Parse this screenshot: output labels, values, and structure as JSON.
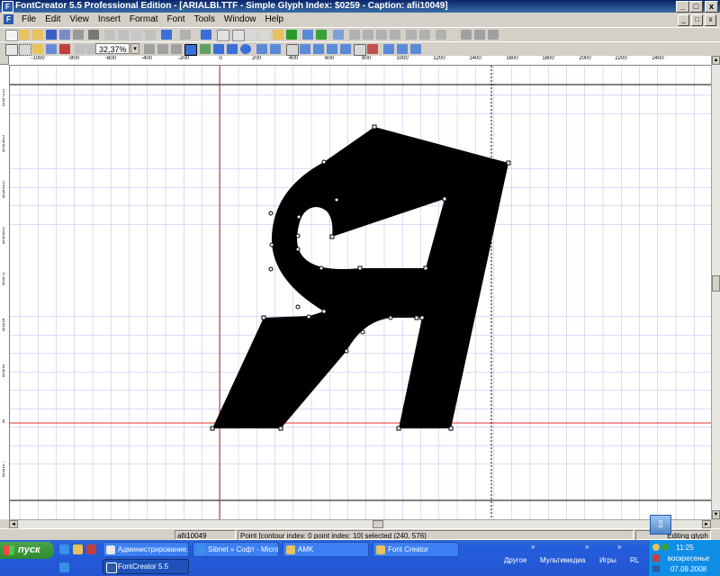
{
  "window": {
    "title": "FontCreator 5.5 Professional Edition - [ARIALBI.TTF - Simple Glyph Index: $0259 - Caption: afii10049]",
    "app_icon": "F",
    "minimize": "_",
    "maximize": "□",
    "close": "x"
  },
  "menu": {
    "doc_icon": "F",
    "items": [
      "File",
      "Edit",
      "View",
      "Insert",
      "Format",
      "Font",
      "Tools",
      "Window",
      "Help"
    ],
    "doc_buttons": [
      "_",
      "□",
      "x"
    ]
  },
  "toolbar2": {
    "zoom_value": "32,37%",
    "zoom_arrow": "▾"
  },
  "rulers": {
    "h_labels": [
      "-1000",
      "-800",
      "-600",
      "-400",
      "-200",
      "0",
      "200",
      "400",
      "600",
      "800",
      "1000",
      "1200",
      "1400",
      "1600",
      "1800",
      "2000",
      "2200",
      "2400"
    ],
    "v_labels": [
      "1750",
      "1500",
      "1250",
      "1000",
      "750",
      "500",
      "250",
      "0",
      "-250"
    ]
  },
  "glyph": {
    "name": "afii10049",
    "character": "Я",
    "colors": {
      "fill": "#000000",
      "grid": "#b8b8f0",
      "baseline": "#e03030",
      "origin_line": "#c03030",
      "metric_line": "#000000"
    }
  },
  "scrollbars": {
    "up": "▲",
    "down": "▼",
    "left": "◄",
    "right": "►"
  },
  "statusbar": {
    "glyph_name": "afii10049",
    "message": "Point [contour index: 0 point index: 10] selected (240, 576)",
    "mode": "Editing glyph",
    "editing_icon": "⇩"
  },
  "taskbar": {
    "start": "пуск",
    "tasks_row1": [
      "Администрирование...",
      "Sibnet » Софт - Micro...",
      "AMK",
      "Font Creator"
    ],
    "tasks_row2": [
      "FontCreator 5.5"
    ],
    "tray_labels": [
      "Другое",
      "Мультимедиа",
      "Игры",
      "RL"
    ],
    "tray_chevrons": [
      "»",
      "»",
      "»"
    ],
    "clock_time": "11:25",
    "clock_day": "воскресенье",
    "clock_date": "07.09.2008"
  }
}
